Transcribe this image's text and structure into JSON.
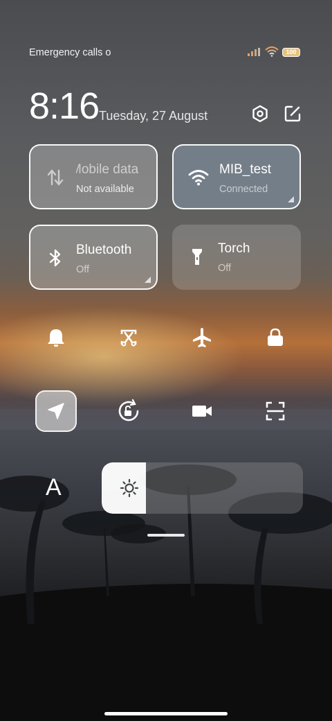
{
  "status_bar": {
    "emergency_text": "Emergency calls o",
    "battery_level": "100",
    "icons": [
      "cellular-signal-icon",
      "wifi-icon",
      "battery-icon"
    ]
  },
  "header": {
    "time": "8:16",
    "date": "Tuesday, 27 August",
    "icons": [
      "settings-icon",
      "edit-icon"
    ]
  },
  "tiles": [
    {
      "name": "Mobile data",
      "display_name": "Mobile data",
      "status": "Not available",
      "active": false,
      "icon": "mobile-data-icon"
    },
    {
      "name": "MIB_test",
      "status": "Connected",
      "active": true,
      "icon": "wifi-icon"
    },
    {
      "name": "Bluetooth",
      "status": "Off",
      "active": false,
      "icon": "bluetooth-icon"
    },
    {
      "name": "Torch",
      "status": "Off",
      "active": false,
      "icon": "torch-icon"
    }
  ],
  "toggles": [
    {
      "name": "ring-icon"
    },
    {
      "name": "screenshot-icon"
    },
    {
      "name": "airplane-mode-icon"
    },
    {
      "name": "lock-screen-icon"
    },
    {
      "name": "location-icon",
      "active": true
    },
    {
      "name": "rotation-lock-icon"
    },
    {
      "name": "screen-recorder-icon"
    },
    {
      "name": "scanner-icon"
    }
  ],
  "brightness": {
    "auto_label": "A",
    "level": 0.22
  },
  "colors": {
    "accent_active_tile": "#788491",
    "battery": "#e8c27a"
  }
}
